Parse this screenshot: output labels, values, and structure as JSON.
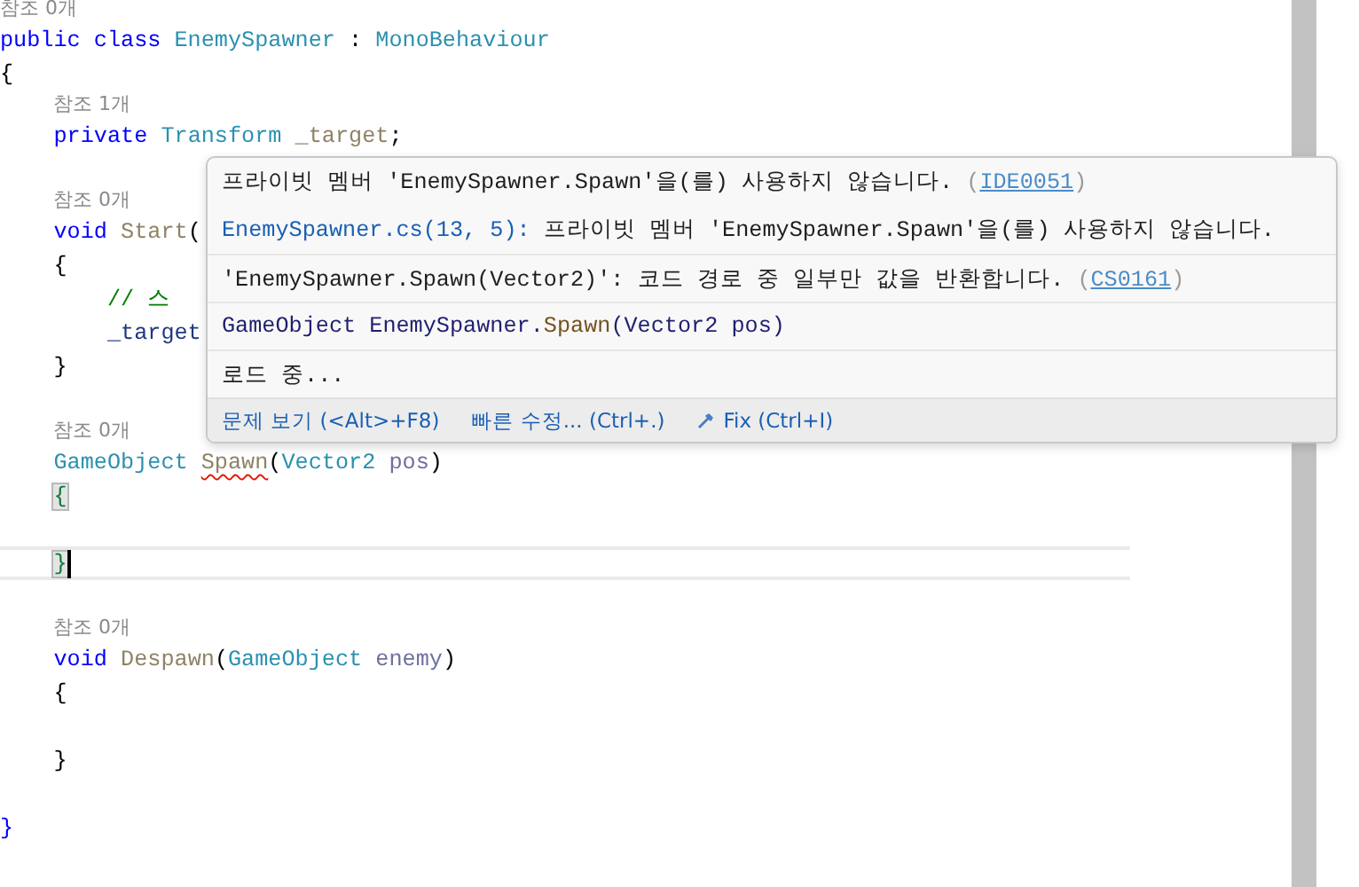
{
  "editor": {
    "lines": [
      {
        "kind": "lens",
        "text": "참조 0개"
      },
      {
        "kind": "code",
        "tokens": [
          {
            "text": "public class ",
            "kind": "keyword"
          },
          {
            "text": "EnemySpawner",
            "kind": "type"
          },
          {
            "text": " : ",
            "kind": "plain"
          },
          {
            "text": "MonoBehaviour",
            "kind": "type"
          }
        ]
      },
      {
        "kind": "code",
        "tokens": [
          {
            "text": "{",
            "kind": "punct"
          }
        ]
      },
      {
        "kind": "lens",
        "text": "참조 1개"
      },
      {
        "kind": "code",
        "tokens": [
          {
            "text": "    private ",
            "kind": "keyword"
          },
          {
            "text": "Transform ",
            "kind": "type"
          },
          {
            "text": "_target",
            "kind": "unused"
          },
          {
            "text": ";",
            "kind": "plain"
          }
        ]
      },
      {
        "kind": "blank"
      },
      {
        "kind": "lens",
        "text": "참조 0개"
      },
      {
        "kind": "code",
        "tokens": [
          {
            "text": "    void ",
            "kind": "keyword"
          },
          {
            "text": "Start",
            "kind": "unused"
          },
          {
            "text": "(",
            "kind": "punct"
          }
        ]
      },
      {
        "kind": "code",
        "tokens": [
          {
            "text": "    {",
            "kind": "punct"
          }
        ]
      },
      {
        "kind": "code",
        "tokens": [
          {
            "text": "        // 스",
            "kind": "comment"
          }
        ]
      },
      {
        "kind": "code",
        "tokens": [
          {
            "text": "        _target",
            "kind": "field"
          }
        ]
      },
      {
        "kind": "code",
        "tokens": [
          {
            "text": "    }",
            "kind": "punct"
          }
        ]
      },
      {
        "kind": "blank"
      },
      {
        "kind": "lens",
        "text": "참조 0개"
      },
      {
        "kind": "code",
        "tokens": [
          {
            "text": "    GameObject ",
            "kind": "type"
          },
          {
            "text": "Spawn",
            "kind": "unused",
            "error": true
          },
          {
            "text": "(",
            "kind": "punct"
          },
          {
            "text": "Vector2 ",
            "kind": "type"
          },
          {
            "text": "pos",
            "kind": "param"
          },
          {
            "text": ")",
            "kind": "punct"
          }
        ]
      },
      {
        "kind": "code",
        "tokens": [
          {
            "text": "    {",
            "kind": "punct",
            "highlight": true
          }
        ]
      },
      {
        "kind": "blank"
      },
      {
        "kind": "code",
        "current": true,
        "caret": true,
        "tokens": [
          {
            "text": "    }",
            "kind": "punct",
            "highlight": true
          }
        ]
      },
      {
        "kind": "blank"
      },
      {
        "kind": "lens",
        "text": "참조 0개"
      },
      {
        "kind": "code",
        "tokens": [
          {
            "text": "    void ",
            "kind": "keyword"
          },
          {
            "text": "Despawn",
            "kind": "unused"
          },
          {
            "text": "(",
            "kind": "punct"
          },
          {
            "text": "GameObject ",
            "kind": "type"
          },
          {
            "text": "enemy",
            "kind": "param"
          },
          {
            "text": ")",
            "kind": "punct"
          }
        ]
      },
      {
        "kind": "code",
        "tokens": [
          {
            "text": "    {",
            "kind": "punct"
          }
        ]
      },
      {
        "kind": "blank"
      },
      {
        "kind": "code",
        "tokens": [
          {
            "text": "    }",
            "kind": "punct"
          }
        ]
      },
      {
        "kind": "blank"
      },
      {
        "kind": "code",
        "tokens": [
          {
            "text": "}",
            "kind": "brace"
          }
        ]
      }
    ]
  },
  "popup": {
    "rows": [
      {
        "parts": [
          {
            "text": "프라이빗 멤버 'EnemySpawner.Spawn'을(를) 사용하지 않습니다. ",
            "kind": "plain"
          },
          {
            "text": "(",
            "kind": "muted"
          },
          {
            "text": "IDE0051",
            "kind": "code_link"
          },
          {
            "text": ")",
            "kind": "muted"
          }
        ]
      },
      {
        "parts": [
          {
            "text": "EnemySpawner.cs(13, 5):",
            "kind": "location_link"
          },
          {
            "text": " 프라이빗 멤버 'EnemySpawner.Spawn'을(를) 사용하지 않습니다.",
            "kind": "plain"
          }
        ]
      },
      {
        "parts": [
          {
            "text": "'EnemySpawner.Spawn(Vector2)': 코드 경로 중 일부만 값을 반환합니다. ",
            "kind": "plain"
          },
          {
            "text": "(",
            "kind": "muted"
          },
          {
            "text": "CS0161",
            "kind": "code_link"
          },
          {
            "text": ")",
            "kind": "muted"
          }
        ]
      },
      {
        "parts": [
          {
            "text": "GameObject EnemySpawner.",
            "kind": "signature"
          },
          {
            "text": "Spawn",
            "kind": "method"
          },
          {
            "text": "(Vector2 pos)",
            "kind": "signature"
          }
        ]
      },
      {
        "parts": [
          {
            "text": "로드 중...",
            "kind": "plain"
          }
        ]
      }
    ],
    "footer": [
      {
        "label": "문제 보기 (<Alt>+F8)",
        "icon": false
      },
      {
        "label": "빠른 수정... (Ctrl+.)",
        "icon": false
      },
      {
        "label": "Fix (Ctrl+I)",
        "icon": true
      }
    ]
  }
}
